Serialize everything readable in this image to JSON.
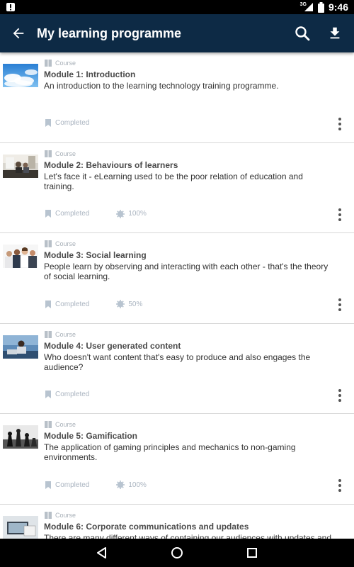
{
  "status": {
    "network": "3G",
    "time": "9:46"
  },
  "appbar": {
    "title": "My learning programme",
    "background": "#0d2a45"
  },
  "items": [
    {
      "type": "Course",
      "title": "Module 1: Introduction",
      "description": "An introduction to the learning technology training programme.",
      "status": "Completed",
      "score": null,
      "thumb": "sky"
    },
    {
      "type": "Course",
      "title": "Module 2: Behaviours of learners",
      "description": "Let's face it - eLearning used to be the poor relation of education and training.",
      "status": "Completed",
      "score": "100%",
      "thumb": "office"
    },
    {
      "type": "Course",
      "title": "Module 3: Social learning",
      "description": "People learn by observing and interacting with each other - that's the theory of social learning.",
      "status": "Completed",
      "score": "50%",
      "thumb": "people"
    },
    {
      "type": "Course",
      "title": "Module 4: User generated content",
      "description": "Who doesn't want content that's easy to produce and also engages the audience?",
      "status": "Completed",
      "score": null,
      "thumb": "desk"
    },
    {
      "type": "Course",
      "title": "Module 5: Gamification",
      "description": "The application of gaming principles and mechanics to non-gaming environments.",
      "status": "Completed",
      "score": "100%",
      "thumb": "chess"
    },
    {
      "type": "Course",
      "title": "Module 6: Corporate communications and updates",
      "description": "There are many different ways of containing our audiences with updates and",
      "status": null,
      "score": null,
      "thumb": "screen"
    }
  ],
  "icons": {
    "back": "arrow-back-icon",
    "search": "search-icon",
    "download": "download-icon",
    "nav": [
      "back-triangle-icon",
      "home-circle-icon",
      "recents-square-icon"
    ]
  }
}
